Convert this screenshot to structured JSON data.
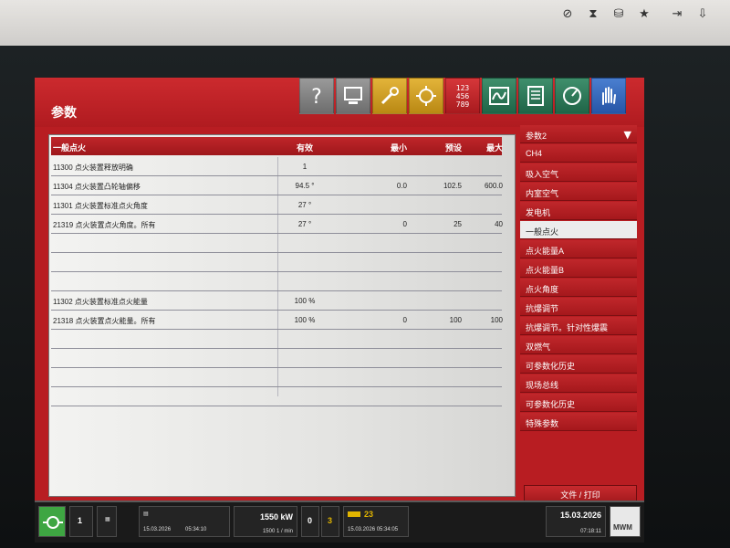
{
  "page_title": "参数",
  "toolbar": {
    "icons": [
      "help-icon",
      "monitor-icon",
      "tools-icon",
      "engine-icon",
      "numpad-icon",
      "waveform-icon",
      "list-icon",
      "gauge-icon",
      "hand-icon"
    ],
    "numpad_rows": [
      "123",
      "456",
      "789"
    ]
  },
  "table": {
    "headers": {
      "name": "一般点火",
      "effective": "有效",
      "min": "最小",
      "default": "预设",
      "max": "最大"
    },
    "rows": [
      {
        "name": "11300 点火装置释放明确",
        "effective": "1",
        "min": "",
        "default": "",
        "max": ""
      },
      {
        "name": "11304 点火装置凸轮轴偏移",
        "effective": "94.5 °",
        "min": "0.0",
        "default": "102.5",
        "max": "600.0"
      },
      {
        "name": "11301 点火装置标准点火角度",
        "effective": "27 °",
        "min": "",
        "default": "",
        "max": ""
      },
      {
        "name": "21319 点火装置点火角度。所有",
        "effective": "27 °",
        "min": "0",
        "default": "25",
        "max": "40"
      },
      {
        "name": "",
        "effective": "",
        "min": "",
        "default": "",
        "max": ""
      },
      {
        "name": "",
        "effective": "",
        "min": "",
        "default": "",
        "max": ""
      },
      {
        "name": "",
        "effective": "",
        "min": "",
        "default": "",
        "max": ""
      },
      {
        "name": "11302 点火装置标准点火能量",
        "effective": "100 %",
        "min": "",
        "default": "",
        "max": ""
      },
      {
        "name": "21318 点火装置点火能量。所有",
        "effective": "100 %",
        "min": "0",
        "default": "100",
        "max": "100"
      },
      {
        "name": "",
        "effective": "",
        "min": "",
        "default": "",
        "max": ""
      },
      {
        "name": "",
        "effective": "",
        "min": "",
        "default": "",
        "max": ""
      },
      {
        "name": "",
        "effective": "",
        "min": "",
        "default": "",
        "max": ""
      },
      {
        "name": "",
        "effective": "",
        "min": "",
        "default": "",
        "max": ""
      }
    ]
  },
  "sidebar": {
    "items": [
      "参数2",
      "CH4",
      "吸入空气",
      "内室空气",
      "发电机",
      "一般点火",
      "点火能量A",
      "点火能量B",
      "点火角度",
      "抗爆调节",
      "抗爆调节。针对性爆震",
      "双燃气",
      "可参数化历史",
      "现场总线",
      "可参数化历史",
      "特殊参数"
    ],
    "active_index": 5
  },
  "print_button": "文件 / 打印",
  "status": {
    "value_1": "1",
    "date_1": "15.03.2026",
    "time_1": "05:34:10",
    "power": "1550 kW",
    "speed": "1500 1 / min",
    "count_0": "0",
    "count_3": "3",
    "alarm": "23",
    "alarm_date": "15.03.2026 05:34:05",
    "date": "15.03.2026",
    "time": "07:18:11",
    "brand": "MWM"
  },
  "colors": {
    "frame_red": "#b81d22",
    "header_red": "#c0262a",
    "active_bg": "#ececec",
    "status_green": "#3ea642",
    "status_yellow": "#e0b400"
  }
}
